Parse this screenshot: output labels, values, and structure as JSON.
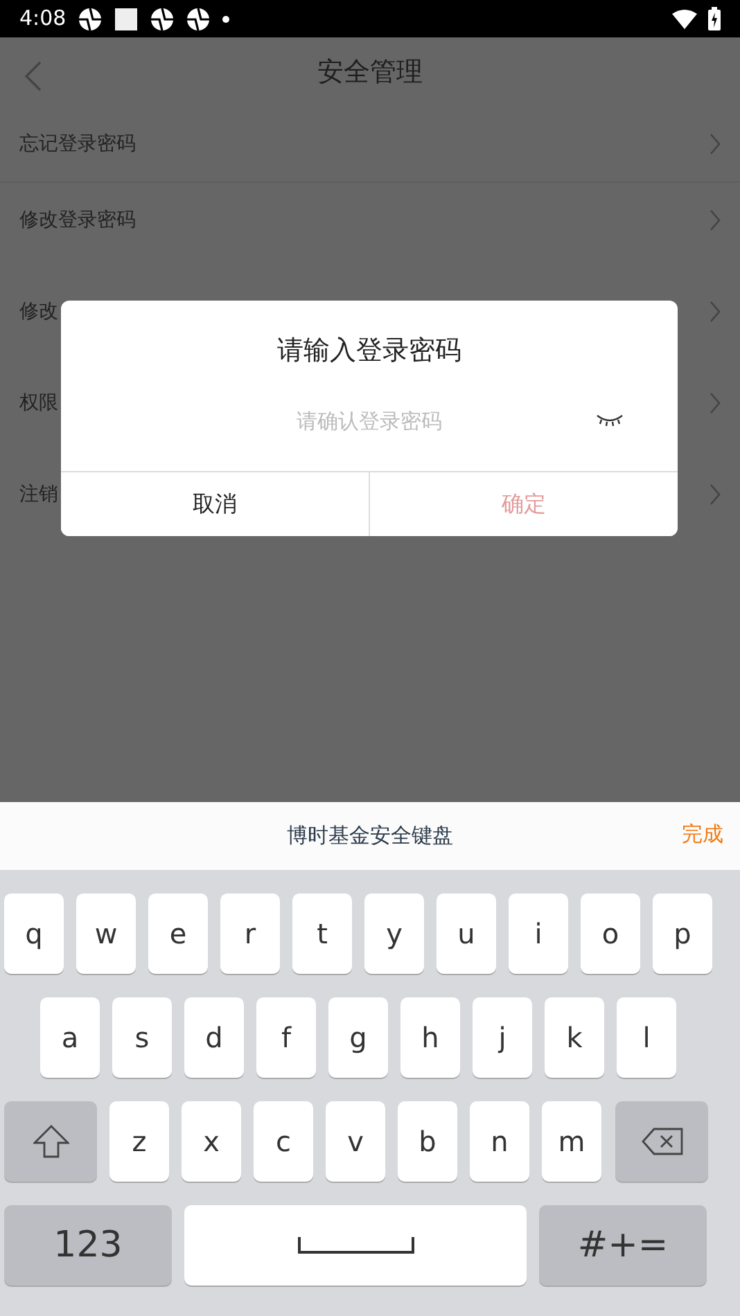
{
  "status_bar": {
    "time": "4:08"
  },
  "header": {
    "title": "安全管理"
  },
  "menu_groups": [
    {
      "items": [
        {
          "label": "忘记登录密码"
        },
        {
          "label": "修改登录密码"
        }
      ]
    },
    {
      "items": [
        {
          "label": "修改"
        }
      ]
    },
    {
      "items": [
        {
          "label": "权限"
        }
      ]
    },
    {
      "items": [
        {
          "label": "注销"
        }
      ]
    }
  ],
  "dialog": {
    "title": "请输入登录密码",
    "placeholder": "请确认登录密码",
    "password_visible": false,
    "buttons": [
      {
        "label": "取消",
        "disabled": false
      },
      {
        "label": "确定",
        "disabled": true
      }
    ]
  },
  "keyboard": {
    "title": "博时基金安全键盘",
    "done": "完成",
    "rows": [
      {
        "keys": [
          {
            "kind": "char",
            "label": "q"
          },
          {
            "kind": "char",
            "label": "w"
          },
          {
            "kind": "char",
            "label": "e"
          },
          {
            "kind": "char",
            "label": "r"
          },
          {
            "kind": "char",
            "label": "t"
          },
          {
            "kind": "char",
            "label": "y"
          },
          {
            "kind": "char",
            "label": "u"
          },
          {
            "kind": "char",
            "label": "i"
          },
          {
            "kind": "char",
            "label": "o"
          },
          {
            "kind": "char",
            "label": "p"
          }
        ]
      },
      {
        "keys": [
          {
            "kind": "char",
            "label": "a"
          },
          {
            "kind": "char",
            "label": "s"
          },
          {
            "kind": "char",
            "label": "d"
          },
          {
            "kind": "char",
            "label": "f"
          },
          {
            "kind": "char",
            "label": "g"
          },
          {
            "kind": "char",
            "label": "h"
          },
          {
            "kind": "char",
            "label": "j"
          },
          {
            "kind": "char",
            "label": "k"
          },
          {
            "kind": "char",
            "label": "l"
          }
        ]
      },
      {
        "keys": [
          {
            "kind": "shift"
          },
          {
            "kind": "char",
            "label": "z"
          },
          {
            "kind": "char",
            "label": "x"
          },
          {
            "kind": "char",
            "label": "c"
          },
          {
            "kind": "char",
            "label": "v"
          },
          {
            "kind": "char",
            "label": "b"
          },
          {
            "kind": "char",
            "label": "n"
          },
          {
            "kind": "char",
            "label": "m"
          },
          {
            "kind": "backspace"
          }
        ]
      },
      {
        "keys": [
          {
            "kind": "mode",
            "label": "123"
          },
          {
            "kind": "space"
          },
          {
            "kind": "mode",
            "label": "#+="
          }
        ]
      }
    ]
  }
}
